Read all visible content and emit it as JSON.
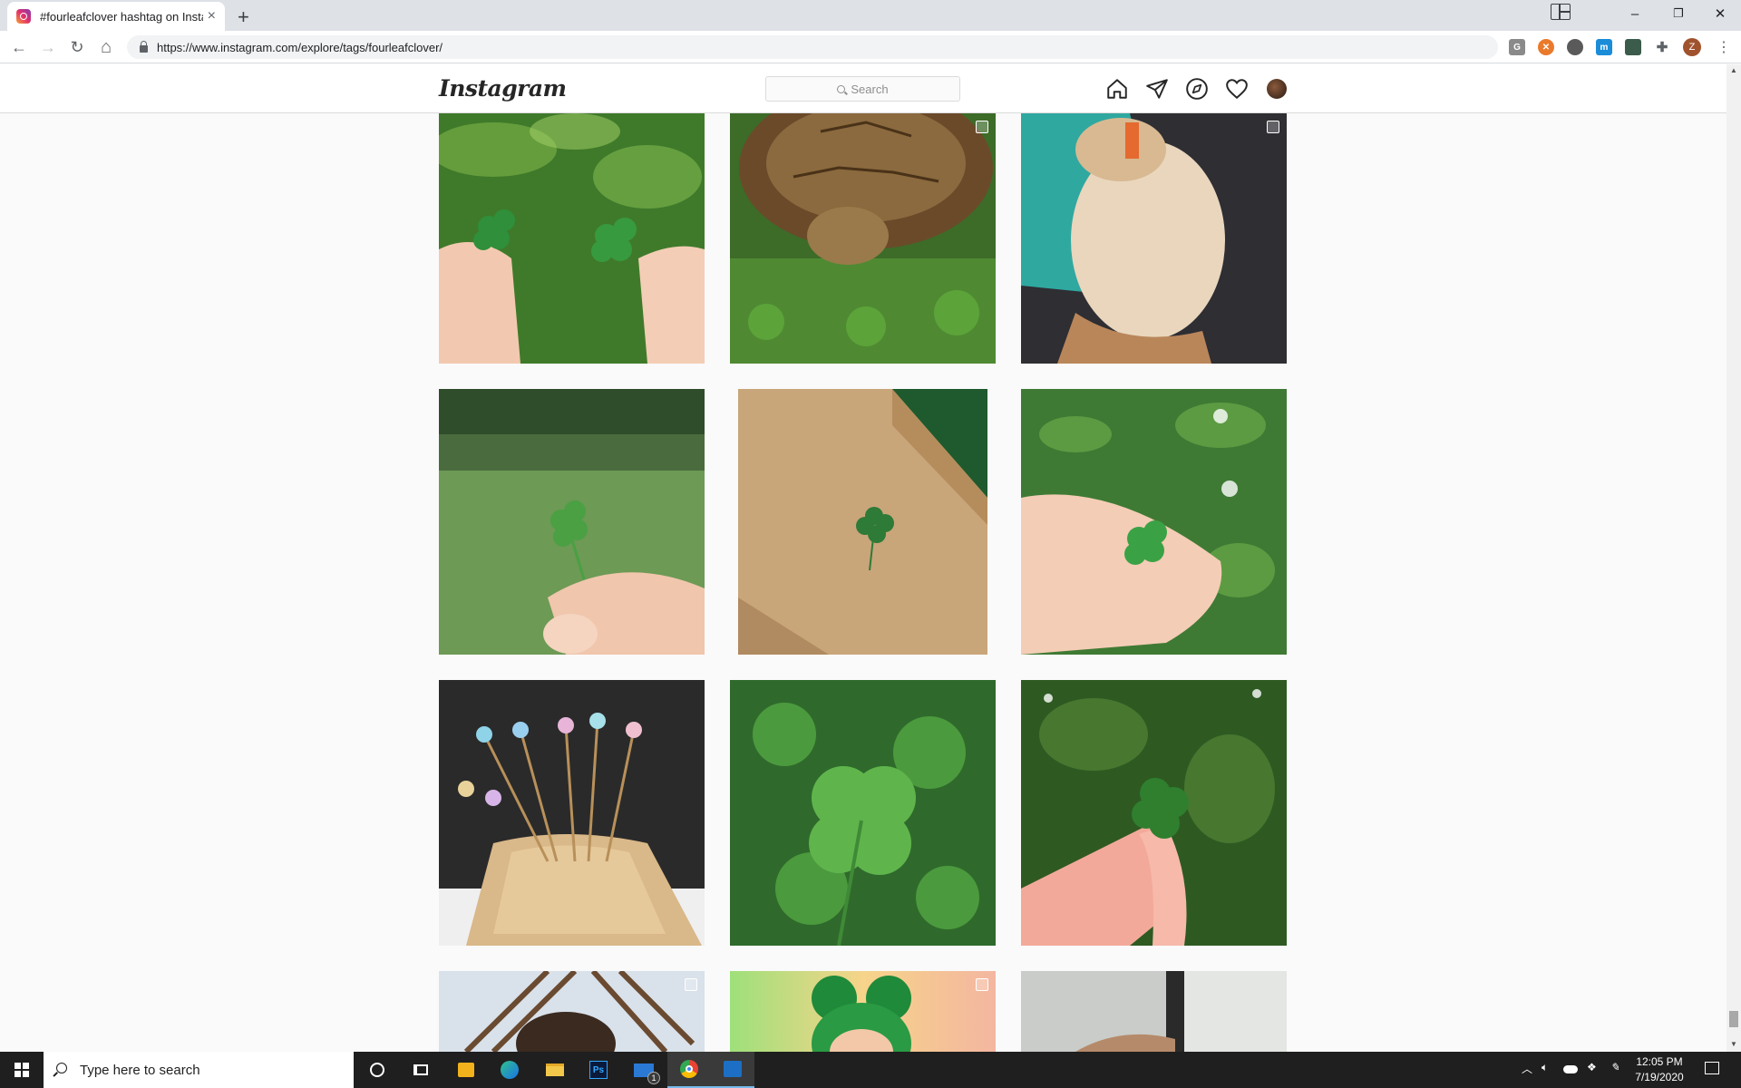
{
  "browser": {
    "tab_title": "#fourleafclover hashtag on Instagram",
    "tab_close": "×",
    "new_tab": "+",
    "url": "https://www.instagram.com/explore/tags/fourleafclover/",
    "window_controls": {
      "minimize": "–",
      "restore": "❐",
      "close": "✕"
    },
    "nav": {
      "back": "←",
      "forward": "→",
      "reload": "↻",
      "home": "⌂"
    },
    "profile_initial": "Z",
    "menu": "⋮"
  },
  "instagram": {
    "logo": "Instagram",
    "search_placeholder": "Search",
    "nav_icons": [
      "home-icon",
      "direct-message-icon",
      "explore-icon",
      "activity-heart-icon",
      "profile-avatar"
    ]
  },
  "posts": [
    {
      "subject": "hands holding four-leaf clovers",
      "multi": false
    },
    {
      "subject": "tortoise in clover",
      "multi": true
    },
    {
      "subject": "sleeping dog",
      "multi": true
    },
    {
      "subject": "clover held over lawn",
      "multi": false
    },
    {
      "subject": "clover on cardboard box",
      "multi": false
    },
    {
      "subject": "hand holding clover in grass",
      "multi": false
    },
    {
      "subject": "clover pins in bread holder",
      "multi": false
    },
    {
      "subject": "clover patch",
      "multi": false
    },
    {
      "subject": "fingers holding clover",
      "multi": false
    },
    {
      "subject": "chair and person",
      "multi": true
    },
    {
      "subject": "green-haired doll",
      "multi": true
    },
    {
      "subject": "hand near wall",
      "multi": false
    }
  ],
  "taskbar": {
    "search_placeholder": "Type here to search",
    "mail_badge": "1",
    "time": "12:05 PM",
    "date": "7/19/2020"
  }
}
